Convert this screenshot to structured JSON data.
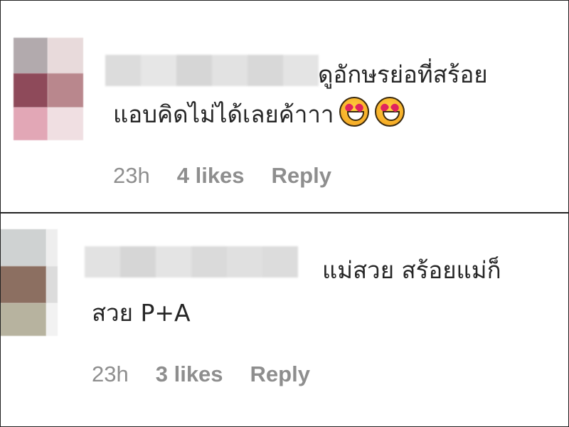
{
  "comments": [
    {
      "text_line1": "ดูอักษรย่อที่สร้อย",
      "text_line2": "แอบคิดไม่ได้เลยค้าาา",
      "emojis": [
        "smiling-face-with-heart-eyes-icon",
        "smiling-face-with-heart-eyes-icon"
      ],
      "time": "23h",
      "likes": "4 likes",
      "reply_label": "Reply",
      "avatar_colors": [
        "#b2aaad",
        "#e8dadb",
        "#8e4a5a",
        "#b9878d",
        "#e2a7b6",
        "#f0dfe2"
      ],
      "name_blur_colors": [
        "#dcdcdc",
        "#e6e6e6",
        "#d6d6d6",
        "#e2e2e2",
        "#d8d8d8",
        "#e4e4e4"
      ]
    },
    {
      "text_line1": "แม่สวย สร้อยแม่ก็",
      "text_line2": "สวย P+A",
      "emojis": [],
      "time": "23h",
      "likes": "3 likes",
      "reply_label": "Reply",
      "avatar_colors": [
        "#cfd2d2",
        "#eeeeee",
        "#8c6f61",
        "#dcdcdc",
        "#b7b39f",
        "#f2f2f2"
      ],
      "name_blur_colors": [
        "#e2e2e2",
        "#d6d6d6",
        "#e4e4e4",
        "#dadada",
        "#e0e0e0",
        "#dcdcdc"
      ]
    }
  ]
}
